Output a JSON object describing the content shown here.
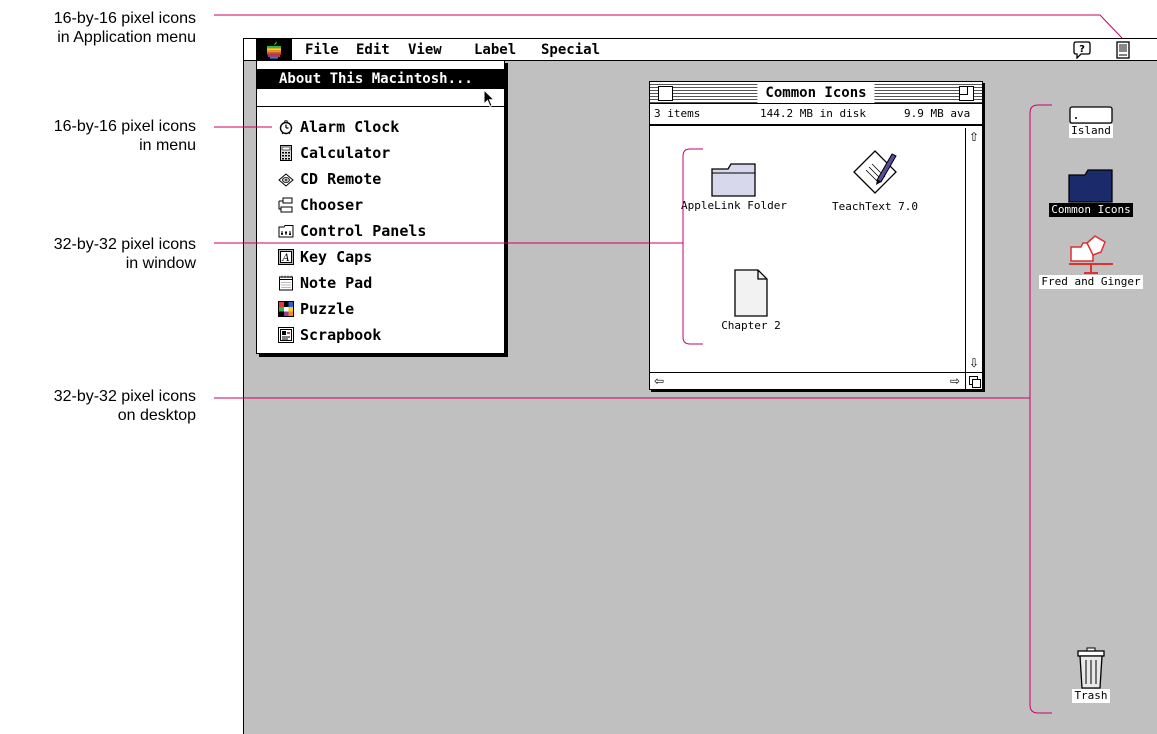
{
  "callouts": {
    "app_menu": {
      "line1": "16-by-16 pixel icons",
      "line2": "in Application menu"
    },
    "menu": {
      "line1": "16-by-16 pixel icons",
      "line2": "in menu"
    },
    "window": {
      "line1": "32-by-32 pixel icons",
      "line2": "in window"
    },
    "desktop": {
      "line1": "32-by-32 pixel icons",
      "line2": "on desktop"
    }
  },
  "menubar": {
    "items": [
      "File",
      "Edit",
      "View",
      "Label",
      "Special"
    ],
    "icons": [
      "apple-icon",
      "help-balloon-icon",
      "application-menu-icon"
    ]
  },
  "apple_menu": {
    "about": "About This Macintosh...",
    "items": [
      {
        "label": "Alarm Clock",
        "icon": "alarm-clock-icon"
      },
      {
        "label": "Calculator",
        "icon": "calculator-icon"
      },
      {
        "label": "CD Remote",
        "icon": "cd-remote-icon"
      },
      {
        "label": "Chooser",
        "icon": "chooser-icon"
      },
      {
        "label": "Control Panels",
        "icon": "control-panels-icon"
      },
      {
        "label": "Key Caps",
        "icon": "key-caps-icon"
      },
      {
        "label": "Note Pad",
        "icon": "note-pad-icon"
      },
      {
        "label": "Puzzle",
        "icon": "puzzle-icon"
      },
      {
        "label": "Scrapbook",
        "icon": "scrapbook-icon"
      }
    ]
  },
  "window": {
    "title": "Common Icons",
    "info": {
      "items": "3 items",
      "disk": "144.2 MB in disk",
      "available": "9.9 MB ava"
    },
    "icons": [
      {
        "label": "AppleLink Folder",
        "icon": "folder-icon"
      },
      {
        "label": "TeachText 7.0",
        "icon": "teachtext-icon"
      },
      {
        "label": "Chapter 2",
        "icon": "document-icon"
      }
    ]
  },
  "desktop": {
    "icons": [
      {
        "label": "Island",
        "icon": "disk-icon"
      },
      {
        "label": "Common Icons",
        "icon": "folder-icon",
        "selected": true
      },
      {
        "label": "Fred and Ginger",
        "icon": "shared-folder-icon"
      },
      {
        "label": "Trash",
        "icon": "trash-icon"
      }
    ]
  },
  "colors": {
    "callout_line": "#cc0066",
    "desktop": "#c0c0c0",
    "selected_folder": "#1a2a6a",
    "shared_folder": "#e03030"
  }
}
